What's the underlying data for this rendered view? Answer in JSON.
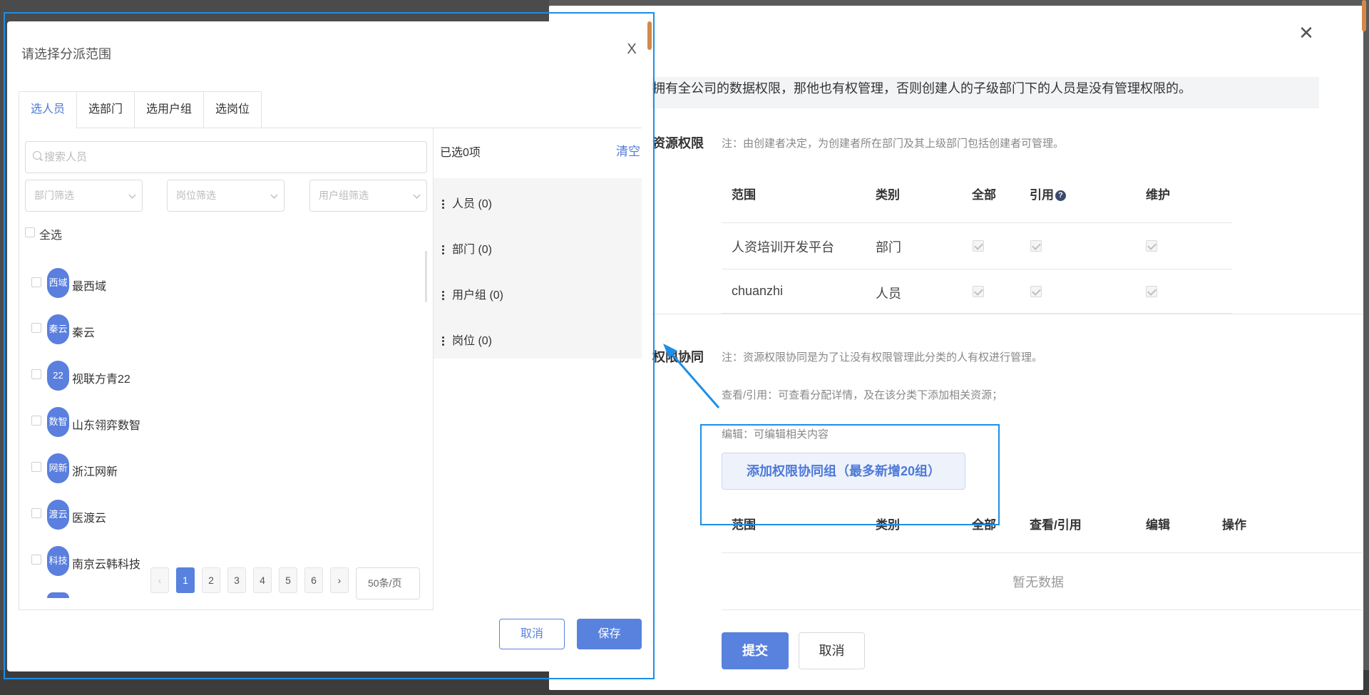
{
  "background_page": {
    "note_top": "拥有全公司的数据权限，那他也有权管理，否则创建人的子级部门下的人员是没有管理权限的。",
    "resource_permission": {
      "title_partial": "资源权限",
      "note": "注：由创建者决定，为创建者所在部门及其上级部门包括创建者可管理。",
      "columns": [
        "范围",
        "类别",
        "全部",
        "引用",
        "维护"
      ],
      "help_icon": "question-circle-icon",
      "rows": [
        {
          "scope": "人资培训开发平台",
          "type": "部门"
        },
        {
          "scope": "chuanzhi",
          "type": "人员"
        }
      ]
    },
    "collab": {
      "title_partial": "权限协同",
      "note1": "注：资源权限协同是为了让没有权限管理此分类的人有权进行管理。",
      "note2": "查看/引用：可查看分配详情，及在该分类下添加相关资源；",
      "note3": "编辑：可编辑相关内容",
      "add_button": "添加权限协同组（最多新增20组）",
      "columns": [
        "范围",
        "类别",
        "全部",
        "查看/引用",
        "编辑",
        "操作"
      ],
      "empty": "暂无数据"
    },
    "submit": "提交",
    "cancel": "取消",
    "close_icon": "close-icon"
  },
  "modal": {
    "title": "请选择分派范围",
    "close": "X",
    "tabs": [
      "选人员",
      "选部门",
      "选用户组",
      "选岗位"
    ],
    "search_placeholder": "搜索人员",
    "filters": [
      "部门筛选",
      "岗位筛选",
      "用户组筛选"
    ],
    "select_all": "全选",
    "people": [
      {
        "avatar": "西域",
        "name": "最西域"
      },
      {
        "avatar": "秦云",
        "name": "秦云"
      },
      {
        "avatar": "22",
        "name": "视联方青22"
      },
      {
        "avatar": "数智",
        "name": "山东翎弈数智"
      },
      {
        "avatar": "网新",
        "name": "浙江网新"
      },
      {
        "avatar": "渡云",
        "name": "医渡云"
      },
      {
        "avatar": "科技",
        "name": "南京云韩科技"
      }
    ],
    "pagination": {
      "prev": "‹",
      "pages": [
        "1",
        "2",
        "3",
        "4",
        "5",
        "6"
      ],
      "current": "1",
      "next": "›",
      "page_size": "50条/页"
    },
    "selected": {
      "header": "已选0项",
      "clear": "清空",
      "groups": [
        "人员 (0)",
        "部门 (0)",
        "用户组 (0)",
        "岗位 (0)"
      ]
    },
    "cancel": "取消",
    "save": "保存"
  },
  "colors": {
    "primary": "#5882dd",
    "annotation": "#1e8ee6",
    "avatar": "#5a7fde"
  }
}
